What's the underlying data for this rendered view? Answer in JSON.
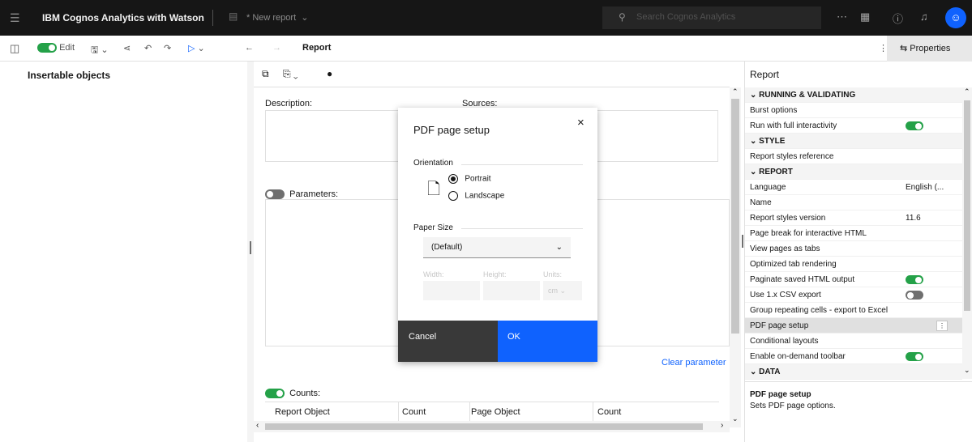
{
  "topbar": {
    "app_name": "IBM Cognos Analytics with Watson",
    "doc_title": "* New report",
    "search_placeholder": "Search Cognos Analytics",
    "avatar_glyph": "☺"
  },
  "toolbar": {
    "edit_label": "Edit",
    "report_title": "Report",
    "properties_label": "Properties"
  },
  "left_panel": {
    "header": "Insertable objects"
  },
  "canvas": {
    "description_label": "Description:",
    "sources_label": "Sources:",
    "parameters_label": "Parameters:",
    "clear_parameters_label": "Clear parameter",
    "counts_label": "Counts:",
    "table_headers": [
      "Report Object",
      "Count",
      "Page Object",
      "Count"
    ],
    "parameters_enabled": false,
    "counts_enabled": true
  },
  "dialog": {
    "title": "PDF page setup",
    "orientation_label": "Orientation",
    "portrait_label": "Portrait",
    "landscape_label": "Landscape",
    "selected_orientation": "Portrait",
    "paper_size_label": "Paper Size",
    "paper_size_value": "(Default)",
    "width_label": "Width:",
    "height_label": "Height:",
    "units_label": "Units:",
    "units_value": "cm",
    "cancel_label": "Cancel",
    "ok_label": "OK"
  },
  "properties": {
    "title": "Report",
    "rows": [
      {
        "label": "RUNNING & VALIDATING",
        "section": true
      },
      {
        "label": "Burst options"
      },
      {
        "label": "Run with full interactivity",
        "toggle": "on"
      },
      {
        "label": "STYLE",
        "section": true
      },
      {
        "label": "Report styles reference"
      },
      {
        "label": "REPORT",
        "section": true
      },
      {
        "label": "Language",
        "value": "English (..."
      },
      {
        "label": "Name"
      },
      {
        "label": "Report styles version",
        "value": "11.6"
      },
      {
        "label": "Page break for interactive HTML"
      },
      {
        "label": "View pages as tabs"
      },
      {
        "label": "Optimized tab rendering"
      },
      {
        "label": "Paginate saved HTML output",
        "toggle": "on"
      },
      {
        "label": "Use 1.x CSV export",
        "toggle": "off"
      },
      {
        "label": "Group repeating cells - export to Excel"
      },
      {
        "label": "PDF page setup",
        "selected": true
      },
      {
        "label": "Conditional layouts"
      },
      {
        "label": "Enable on-demand toolbar",
        "toggle": "on"
      },
      {
        "label": "DATA",
        "section": true
      }
    ],
    "footer_title": "PDF page setup",
    "footer_desc": "Sets PDF page options."
  },
  "colors": {
    "topbar_bg": "#161616",
    "toggle_on": "#24a148",
    "primary_button": "#0f62fe",
    "secondary_button": "#393939",
    "link": "#0f62fe"
  }
}
